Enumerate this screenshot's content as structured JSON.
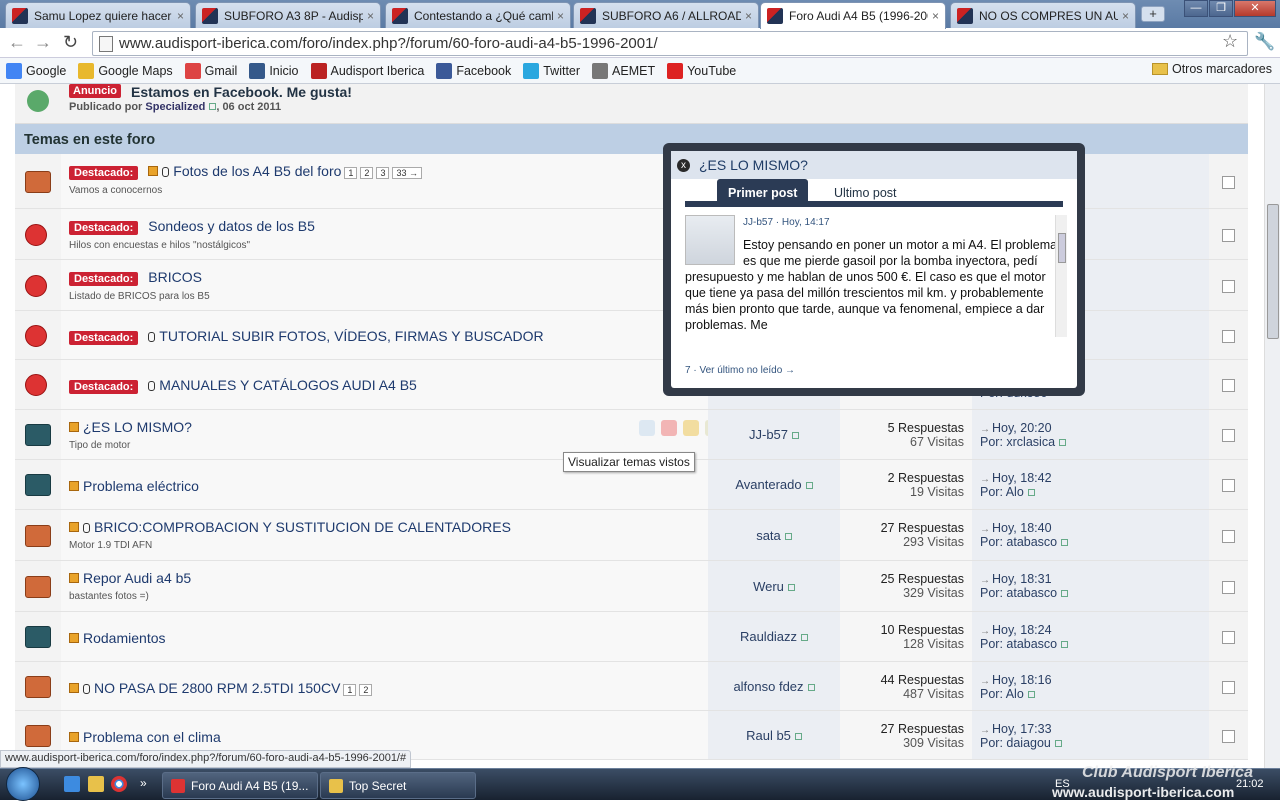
{
  "browser": {
    "tabs": [
      {
        "title": "Samu Lopez quiere hacer u"
      },
      {
        "title": "SUBFORO A3 8P - Audispo"
      },
      {
        "title": "Contestando a ¿Qué camb"
      },
      {
        "title": "SUBFORO A6 / ALLROAD ("
      },
      {
        "title": "Foro Audi A4 B5 (1996-200"
      },
      {
        "title": "NO OS COMPRES UN AUD"
      }
    ],
    "active_tab": 4,
    "new_tab_label": "+",
    "url": "www.audisport-iberica.com/foro/index.php?/forum/60-foro-audi-a4-b5-1996-2001/",
    "window_buttons": [
      "—",
      "❐",
      "✕"
    ],
    "bookmarks": [
      {
        "label": "Google",
        "color": "#4285f4"
      },
      {
        "label": "Google Maps",
        "color": "#e8b82d"
      },
      {
        "label": "Gmail",
        "color": "#d44"
      },
      {
        "label": "Inicio",
        "color": "#35598a"
      },
      {
        "label": "Audisport Iberica",
        "color": "#b22"
      },
      {
        "label": "Facebook",
        "color": "#3b5998"
      },
      {
        "label": "Twitter",
        "color": "#2aa7df"
      },
      {
        "label": "AEMET",
        "color": "#777"
      },
      {
        "label": "YouTube",
        "color": "#d22"
      }
    ],
    "other_bookmarks": "Otros marcadores"
  },
  "announcement": {
    "badge": "Anuncio",
    "title": "Estamos en Facebook. Me gusta!",
    "meta_prefix": "Publicado por",
    "meta_author": "Specialized",
    "meta_date": ", 06 oct 2011"
  },
  "section_title": "Temas en este foro",
  "featured": [
    {
      "badge": "Destacado:",
      "title": "Fotos de los A4 B5 del foro",
      "subtitle": "Vamos a conocernos",
      "pages": [
        "1",
        "2",
        "3",
        "33 →"
      ],
      "icon": "hot",
      "clip": true,
      "doc": true
    },
    {
      "badge": "Destacado:",
      "title": "Sondeos y datos de los B5",
      "subtitle": "Hilos con encuestas e hilos \"nostálgicos\"",
      "pages": [],
      "icon": "lock",
      "clip": false,
      "doc": false
    },
    {
      "badge": "Destacado:",
      "title": "BRICOS",
      "subtitle": "Listado de BRICOS para los B5",
      "pages": [],
      "icon": "lock",
      "clip": false,
      "doc": false
    },
    {
      "badge": "Destacado:",
      "title": "TUTORIAL SUBIR FOTOS, VÍDEOS, FIRMAS Y BUSCADOR",
      "subtitle": "",
      "pages": [],
      "icon": "lock",
      "clip": true,
      "doc": false
    },
    {
      "badge": "Destacado:",
      "title": "MANUALES Y CATÁLOGOS AUDI A4 B5",
      "subtitle": "",
      "pages": [],
      "icon": "lock",
      "clip": true,
      "doc": false
    }
  ],
  "featured_partial": [
    {
      "last_time": ":07"
    },
    {
      "last_time": ":05"
    },
    {
      "last_time": ":29"
    },
    {
      "last_time": ":46"
    },
    {
      "visits": "9174 Visitas",
      "last_by": "Por: duke80",
      "last_time": ":51"
    }
  ],
  "topics": [
    {
      "title": "¿ES LO MISMO?",
      "subtitle": "Tipo de motor",
      "author": "JJ-b57",
      "replies": "5 Respuestas",
      "views": "67 Visitas",
      "last_time": "Hoy, 20:20",
      "last_by": "Por: xrclasica",
      "icon": "norm",
      "clip": false,
      "pages": []
    },
    {
      "title": "Problema eléctrico",
      "subtitle": "",
      "author": "Avanterado",
      "replies": "2 Respuestas",
      "views": "19 Visitas",
      "last_time": "Hoy, 18:42",
      "last_by": "Por: Alo",
      "icon": "norm",
      "clip": false,
      "pages": []
    },
    {
      "title": "BRICO:COMPROBACION Y SUSTITUCION DE CALENTADORES",
      "subtitle": "Motor 1.9 TDI AFN",
      "author": "sata",
      "replies": "27 Respuestas",
      "views": "293 Visitas",
      "last_time": "Hoy, 18:40",
      "last_by": "Por: atabasco",
      "icon": "hot",
      "clip": true,
      "pages": []
    },
    {
      "title": "Repor Audi a4 b5",
      "subtitle": "bastantes fotos =)",
      "author": "Weru",
      "replies": "25 Respuestas",
      "views": "329 Visitas",
      "last_time": "Hoy, 18:31",
      "last_by": "Por: atabasco",
      "icon": "hot",
      "clip": false,
      "pages": []
    },
    {
      "title": "Rodamientos",
      "subtitle": "",
      "author": "Rauldiazz",
      "replies": "10 Respuestas",
      "views": "128 Visitas",
      "last_time": "Hoy, 18:24",
      "last_by": "Por: atabasco",
      "icon": "norm",
      "clip": false,
      "pages": []
    },
    {
      "title": "NO PASA DE 2800 RPM 2.5TDI 150CV",
      "subtitle": "",
      "author": "alfonso fdez",
      "replies": "44 Respuestas",
      "views": "487 Visitas",
      "last_time": "Hoy, 18:16",
      "last_by": "Por: Alo",
      "icon": "hot",
      "clip": true,
      "pages": [
        "1",
        "2"
      ]
    },
    {
      "title": "Problema con el clima",
      "subtitle": "",
      "author": "Raul b5",
      "replies": "27 Respuestas",
      "views": "309 Visitas",
      "last_time": "Hoy, 17:33",
      "last_by": "Por: daiagou",
      "icon": "hot",
      "clip": false,
      "pages": []
    }
  ],
  "tooltip": "Visualizar temas vistos",
  "popup": {
    "title": "¿ES LO MISMO?",
    "close": "x",
    "tab_first": "Primer post",
    "tab_last": "Ultimo post",
    "author": "JJ-b57",
    "date": "· Hoy, 14:17",
    "body": "Estoy pensando en poner un motor a mi A4. El problema es que me pierde gasoil por la bomba inyectora, pedí presupuesto y me hablan de unos 500 €. El caso es que el motor que tiene ya pasa del millón trescientos mil km. y probablemente más bien pronto que tarde, aunque va fenomenal, empiece a dar problemas. Me",
    "footer": "7 · Ver último no leído →"
  },
  "statusbar": "www.audisport-iberica.com/foro/index.php?/forum/60-foro-audi-a4-b5-1996-2001/#",
  "taskbar": {
    "tasks": [
      {
        "label": "Foro Audi A4 B5 (19...",
        "color": "#d33"
      },
      {
        "label": "Top Secret",
        "color": "#e8c14a"
      }
    ],
    "tray": "ES",
    "clock": "21:02"
  },
  "watermark": {
    "line1": "Club Audisport Iberica",
    "line2": "www.audisport-iberica.com"
  }
}
